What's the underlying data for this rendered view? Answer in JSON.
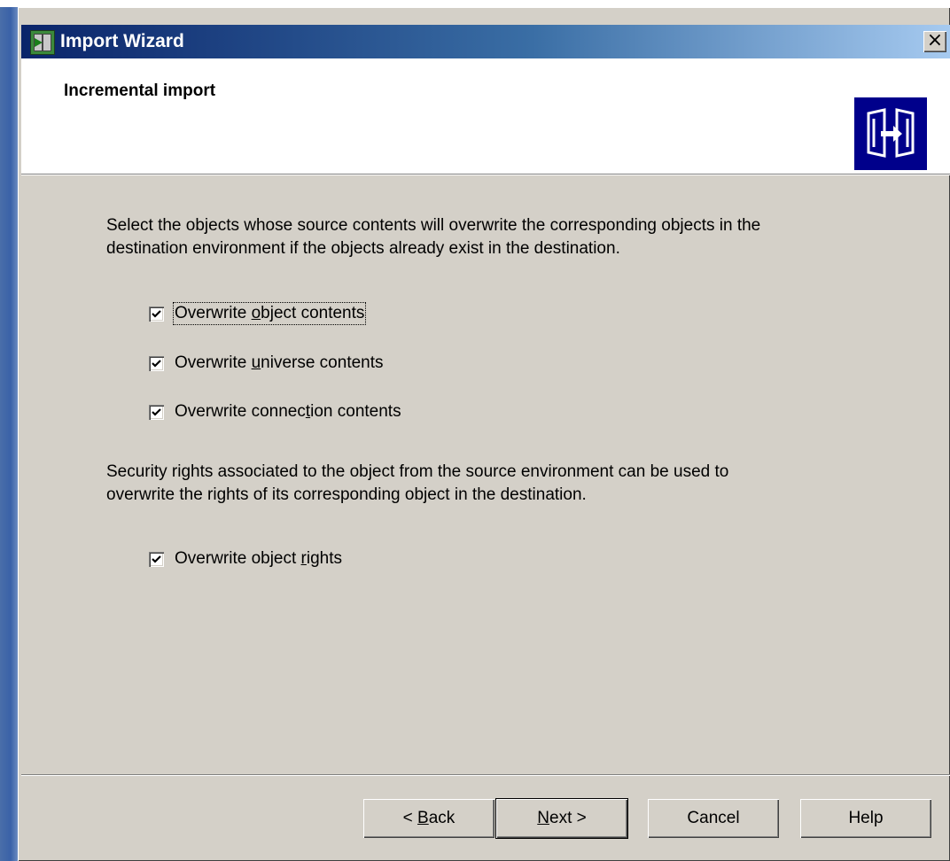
{
  "window": {
    "title": "Import Wizard",
    "close_glyph": "×"
  },
  "header": {
    "title": "Incremental import",
    "graphic_icon": "import-doors-icon"
  },
  "content": {
    "description1_line1": "Select the objects whose source contents will overwrite the corresponding objects in the",
    "description1_line2": "destination environment if the objects already exist in the destination.",
    "options": [
      {
        "pre": "Overwrite ",
        "mnemonic": "o",
        "post": "bject contents",
        "checked": true
      },
      {
        "pre": "Overwrite ",
        "mnemonic": "u",
        "post": "niverse contents",
        "checked": true
      },
      {
        "pre": "Overwrite connec",
        "mnemonic": "t",
        "post": "ion contents",
        "checked": true
      }
    ],
    "description2_line1": "Security rights associated to the object from the source environment can be used to",
    "description2_line2": "overwrite the rights of its corresponding object in the destination.",
    "rights_option": {
      "pre": "Overwrite object ",
      "mnemonic": "r",
      "post": "ights",
      "checked": true
    }
  },
  "buttons": {
    "back_pre": "< ",
    "back_mnemonic": "B",
    "back_post": "ack",
    "next_mnemonic": "N",
    "next_post": "ext >",
    "cancel": "Cancel",
    "help": "Help"
  },
  "colors": {
    "titlebar_start": "#0a246a",
    "titlebar_end": "#a6caf0",
    "dialog_bg": "#d4d0c8",
    "header_graphic_bg": "#00008b"
  }
}
